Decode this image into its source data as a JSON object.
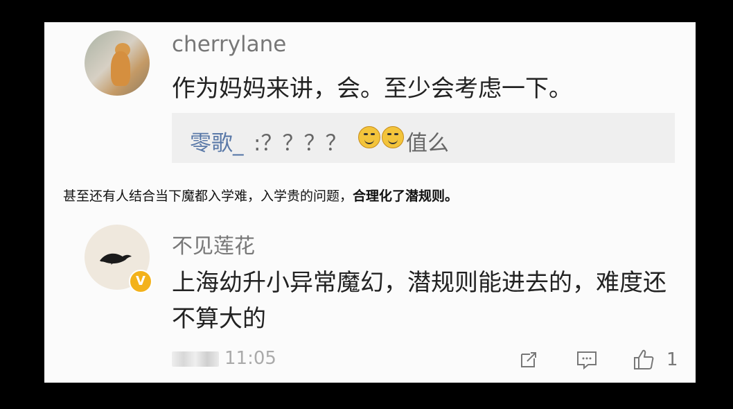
{
  "comments": [
    {
      "username": "cherrylane",
      "text": "作为妈妈来讲，会。至少会考虑一下。",
      "reply": {
        "username": "零歌_",
        "text": ":？？？？",
        "suffix": "值么"
      }
    },
    {
      "username": "不见莲花",
      "text": "上海幼升小异常魔幻，潜规则能进去的，难度还不算大的",
      "time": "11:05",
      "likes": "1"
    }
  ],
  "overlay": {
    "prefix": "甚至还有人结合当下魔都入学难，入学贵的问题，",
    "emphasis": "合理化了潜规则。"
  },
  "icons": {
    "share": "share-icon",
    "comment": "comment-icon",
    "like": "thumbs-up-icon",
    "verified": "verified-badge-icon"
  }
}
